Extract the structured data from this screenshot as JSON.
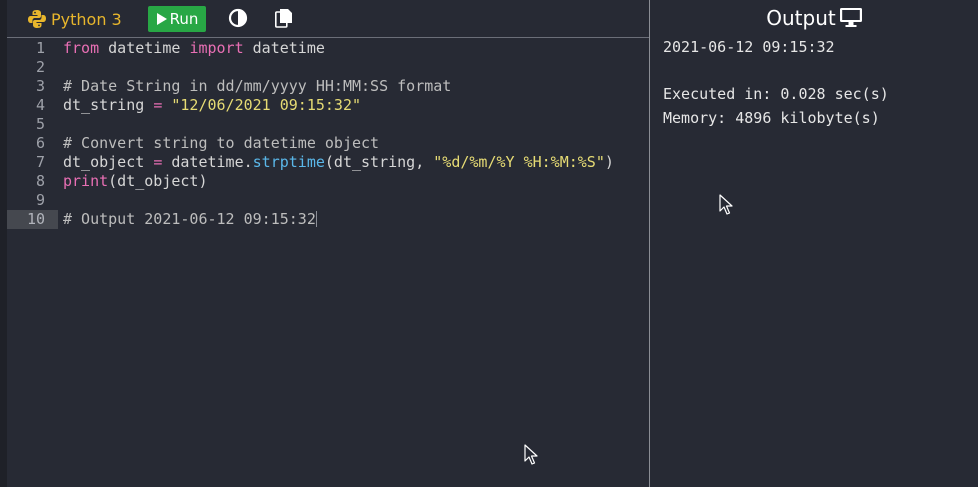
{
  "toolbar": {
    "language": "Python 3",
    "run_label": "Run"
  },
  "editor": {
    "lines": [
      {
        "num": "1",
        "tokens": [
          {
            "t": "from",
            "c": "kw"
          },
          {
            "t": " datetime ",
            "c": ""
          },
          {
            "t": "import",
            "c": "kw"
          },
          {
            "t": " datetime",
            "c": ""
          }
        ]
      },
      {
        "num": "2",
        "tokens": []
      },
      {
        "num": "3",
        "tokens": [
          {
            "t": "# Date String in dd/mm/yyyy HH:MM:SS format",
            "c": "cm"
          }
        ]
      },
      {
        "num": "4",
        "tokens": [
          {
            "t": "dt_string ",
            "c": ""
          },
          {
            "t": "=",
            "c": "op"
          },
          {
            "t": " ",
            "c": ""
          },
          {
            "t": "\"12/06/2021 09:15:32\"",
            "c": "str"
          }
        ]
      },
      {
        "num": "5",
        "tokens": []
      },
      {
        "num": "6",
        "tokens": [
          {
            "t": "# Convert string to datetime object",
            "c": "cm"
          }
        ]
      },
      {
        "num": "7",
        "tokens": [
          {
            "t": "dt_object ",
            "c": ""
          },
          {
            "t": "=",
            "c": "op"
          },
          {
            "t": " datetime.",
            "c": ""
          },
          {
            "t": "strptime",
            "c": "fn"
          },
          {
            "t": "(dt_string, ",
            "c": ""
          },
          {
            "t": "\"%d/%m/%Y %H:%M:%S\"",
            "c": "str"
          },
          {
            "t": ")",
            "c": ""
          }
        ]
      },
      {
        "num": "8",
        "tokens": [
          {
            "t": "print",
            "c": "kw"
          },
          {
            "t": "(dt_object)",
            "c": ""
          }
        ]
      },
      {
        "num": "9",
        "tokens": []
      },
      {
        "num": "10",
        "tokens": [
          {
            "t": "# Output 2021-06-12 09:15:32",
            "c": "cm"
          }
        ],
        "active": true
      }
    ]
  },
  "output": {
    "title": "Output",
    "result": "2021-06-12 09:15:32",
    "executed": "Executed in: 0.028 sec(s)",
    "memory": "Memory: 4896 kilobyte(s)"
  },
  "colors": {
    "background": "#272a34",
    "run_button": "#28a745",
    "language_label": "#e8b62c",
    "keyword": "#e86fb4",
    "string": "#e6db74",
    "function": "#5ab7e9"
  },
  "icons": [
    "python-logo-icon",
    "play-icon",
    "contrast-icon",
    "copy-icon",
    "monitor-icon",
    "mouse-cursor-icon"
  ]
}
